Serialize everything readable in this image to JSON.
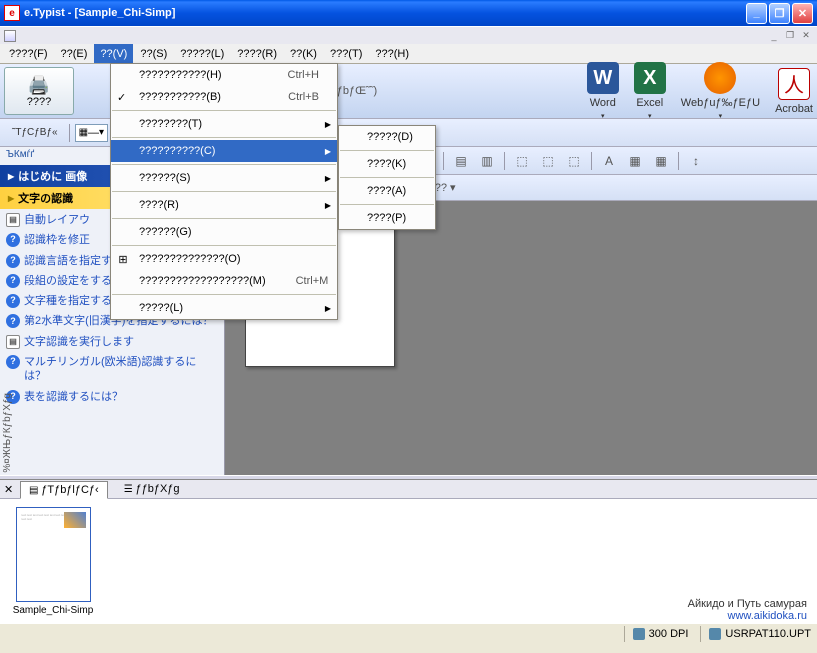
{
  "title": "e.Typist - [Sample_Chi-Simp]",
  "menu": [
    "????(F)",
    "??(E)",
    "??(V)",
    "??(S)",
    "?????(L)",
    "????(R)",
    "??(K)",
    "???(T)",
    "???(H)"
  ],
  "scanner_label": "????",
  "center_label": "ƒTƒ“ƒvƒ‹ƒfƒbƒŒ˜˜)",
  "apps": [
    {
      "label": "Word",
      "cls": "word",
      "glyph": "W"
    },
    {
      "label": "Excel",
      "cls": "excel",
      "glyph": "X"
    },
    {
      "label": "Webƒuƒ‰ƒEƒU",
      "cls": "ff",
      "glyph": "🦊"
    },
    {
      "label": "Acrobat",
      "cls": "acro",
      "glyph": "A"
    }
  ],
  "tb2_left": "˜TƒCƒBƒ«",
  "tb2_drop": "—",
  "help_crumb": "ЪКмѓґ",
  "help_header": "はじめに 画像",
  "help_sub": "文字の認識",
  "help_links": [
    {
      "txt": "自動レイアウ",
      "ico": "doc"
    },
    {
      "txt": "認識枠を修正",
      "ico": "q"
    },
    {
      "txt": "認識言語を指定するには？",
      "ico": "q"
    },
    {
      "txt": "段組の設定をするには？",
      "ico": "q"
    },
    {
      "txt": "文字種を指定するには？",
      "ico": "q"
    },
    {
      "txt": "第2水準文字(旧漢字)を指定するには？",
      "ico": "q"
    },
    {
      "txt": "文字認識を実行します",
      "ico": "doc"
    },
    {
      "txt": "マルチリンガル(欧米語)認識するには？",
      "ico": "q"
    },
    {
      "txt": "表を認識するには？",
      "ico": "q"
    }
  ],
  "dd_main": [
    {
      "t": "???????????(H)",
      "sc": "Ctrl+H",
      "sep": false
    },
    {
      "t": "???????????(B)",
      "sc": "Ctrl+B",
      "sep": false,
      "check": true
    },
    {
      "sep": true
    },
    {
      "t": "????????(T)",
      "arr": true
    },
    {
      "sep": true
    },
    {
      "t": "??????????(C)",
      "arr": true,
      "hl": true
    },
    {
      "sep": true
    },
    {
      "t": "??????(S)",
      "arr": true
    },
    {
      "sep": true
    },
    {
      "t": "????(R)",
      "arr": true
    },
    {
      "sep": true
    },
    {
      "t": "??????(G)"
    },
    {
      "sep": true
    },
    {
      "t": "??????????????(O)",
      "ico": "⊞"
    },
    {
      "t": "??????????????????(M)",
      "sc": "Ctrl+M"
    },
    {
      "sep": true
    },
    {
      "t": "?????(L)",
      "arr": true
    }
  ],
  "dd_sub": [
    "?????(D)",
    "????(K)",
    "????(A)",
    "????(P)"
  ],
  "doc_tb2_label": "?? ▾",
  "thumb_tabs": [
    "ƒTƒbƒlƒCƒ‹",
    "ƒƒbƒXƒg"
  ],
  "thumb_label": "Sample_Chi-Simp",
  "watermark_line1": "Айкидо и Путь самурая",
  "watermark_line2": "www.aikidoka.ru",
  "vtext": "%¤ЖЊƒЌƒbƒXƒg",
  "status_dpi": "300 DPI",
  "status_file": "USRPAT110.UPT"
}
